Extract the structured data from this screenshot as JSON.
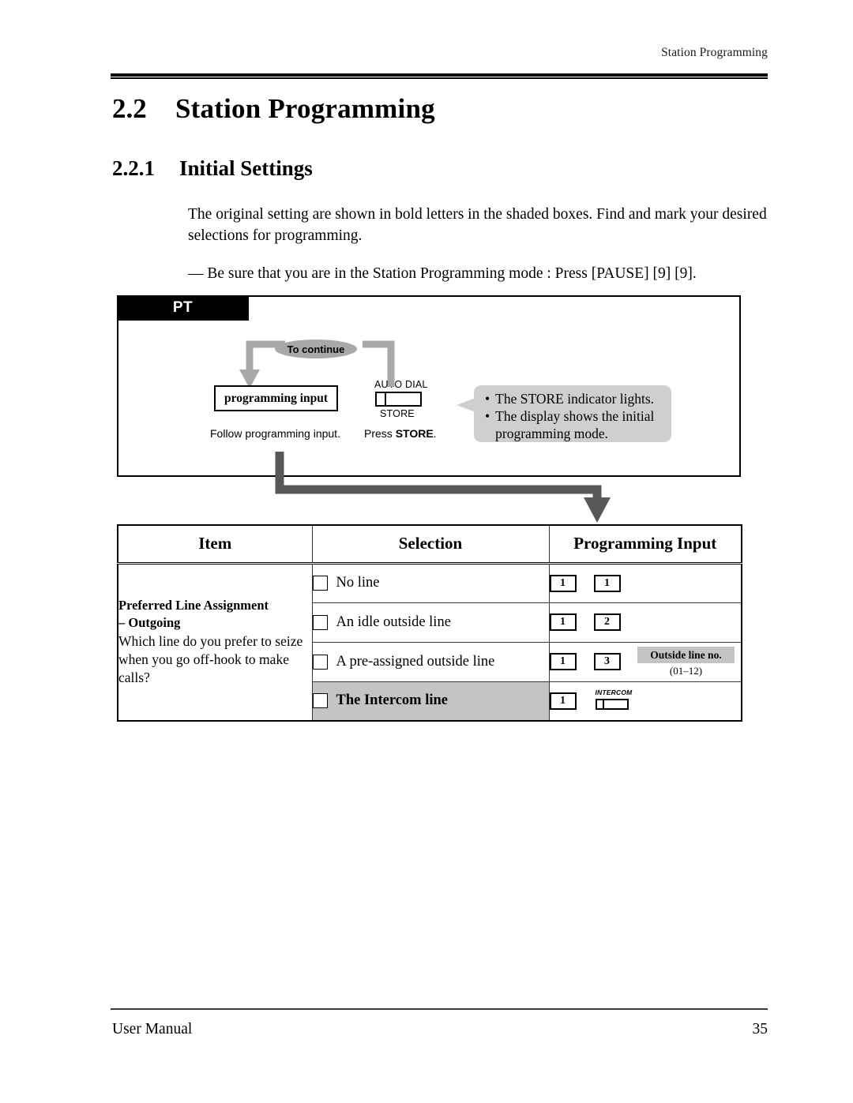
{
  "page": {
    "running_header": "Station Programming",
    "section_number": "2.2",
    "section_title": "Station Programming",
    "subsection_number": "2.2.1",
    "subsection_title": "Initial Settings",
    "intro_paragraph": "The original setting are shown in bold letters in the shaded boxes. Find and mark your desired selections for programming.",
    "note_paragraph": "— Be sure that you are in the Station Programming mode : Press [PAUSE] [9] [9]."
  },
  "diagram": {
    "tab_label": "PT",
    "loop_label": "To continue",
    "programming_input_box": "programming input",
    "programming_input_caption": "Follow programming input.",
    "store_key_top_label": "AUTO DIAL",
    "store_key_bottom_label": "STORE",
    "store_caption_prefix": "Press ",
    "store_caption_key": "STORE",
    "store_caption_suffix": ".",
    "bubble_bullets": [
      "The STORE indicator lights.",
      "The display shows the initial programming mode."
    ]
  },
  "table": {
    "headers": {
      "item": "Item",
      "selection": "Selection",
      "programming_input": "Programming Input"
    },
    "item": {
      "title_line1": "Preferred Line Assignment",
      "title_line2": "– Outgoing",
      "description": "Which line do you prefer to seize when you go off-hook to make calls?"
    },
    "rows": [
      {
        "selection": "No line",
        "keys": [
          "1",
          "1"
        ],
        "shaded": false,
        "extra": null
      },
      {
        "selection": "An idle outside line",
        "keys": [
          "1",
          "2"
        ],
        "shaded": false,
        "extra": null
      },
      {
        "selection": "A pre-assigned outside line",
        "keys": [
          "1",
          "3"
        ],
        "shaded": false,
        "extra": {
          "badge_label": "Outside line no.",
          "badge_range": "(01–12)"
        }
      },
      {
        "selection": "The Intercom line",
        "keys": [
          "1"
        ],
        "shaded": true,
        "intercom_key_label": "INTERCOM"
      }
    ]
  },
  "footer": {
    "left": "User Manual",
    "page_number": "35"
  },
  "colors": {
    "shade_gray": "#c4c4c4",
    "bubble_gray": "#cfcfcf",
    "pill_gray": "#a8a8a8",
    "connector_gray": "#585858",
    "loop_gray": "#a8a8a8"
  }
}
